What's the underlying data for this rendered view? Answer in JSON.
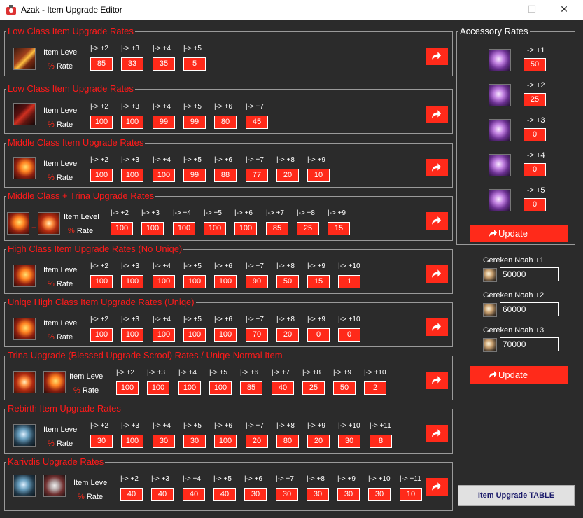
{
  "window": {
    "title": "Azak -  Item Upgrade Editor",
    "minimize": "—",
    "maximize": "☐",
    "close": "✕"
  },
  "labels": {
    "item_level": "Item Level",
    "rate": "% Rate"
  },
  "sections": [
    {
      "title": "Low Class Item Upgrade Rates",
      "levels": [
        "|-> +2",
        "|-> +3",
        "|-> +4",
        "|-> +5"
      ],
      "values": [
        "85",
        "33",
        "35",
        "5"
      ]
    },
    {
      "title": "Low Class Item Upgrade Rates",
      "levels": [
        "|-> +2",
        "|-> +3",
        "|-> +4",
        "|-> +5",
        "|-> +6",
        "|-> +7"
      ],
      "values": [
        "100",
        "100",
        "99",
        "99",
        "80",
        "45"
      ]
    },
    {
      "title": "Middle Class Item Upgrade Rates",
      "levels": [
        "|-> +2",
        "|-> +3",
        "|-> +4",
        "|-> +5",
        "|-> +6",
        "|-> +7",
        "|-> +8",
        "|-> +9"
      ],
      "values": [
        "100",
        "100",
        "100",
        "99",
        "88",
        "77",
        "20",
        "10"
      ]
    },
    {
      "title": "Middle Class + Trina Upgrade Rates",
      "levels": [
        "|-> +2",
        "|-> +3",
        "|-> +4",
        "|-> +5",
        "|-> +6",
        "|-> +7",
        "|-> +8",
        "|-> +9"
      ],
      "values": [
        "100",
        "100",
        "100",
        "100",
        "100",
        "85",
        "25",
        "15"
      ]
    },
    {
      "title": "High Class Item Upgrade Rates (No Uniqe)",
      "levels": [
        "|-> +2",
        "|-> +3",
        "|-> +4",
        "|-> +5",
        "|-> +6",
        "|-> +7",
        "|-> +8",
        "|-> +9",
        "|-> +10"
      ],
      "values": [
        "100",
        "100",
        "100",
        "100",
        "100",
        "90",
        "50",
        "15",
        "1"
      ]
    },
    {
      "title": "Uniqe High Class Item Upgrade Rates (Uniqe)",
      "levels": [
        "|-> +2",
        "|-> +3",
        "|-> +4",
        "|-> +5",
        "|-> +6",
        "|-> +7",
        "|-> +8",
        "|-> +9",
        "|-> +10"
      ],
      "values": [
        "100",
        "100",
        "100",
        "100",
        "100",
        "70",
        "20",
        "0",
        "0"
      ]
    },
    {
      "title": "Trina Upgrade (Blessed Upgrade Scrool) Rates / Uniqe-Normal Item",
      "levels": [
        "|-> +2",
        "|-> +3",
        "|-> +4",
        "|-> +5",
        "|-> +6",
        "|-> +7",
        "|-> +8",
        "|-> +9",
        "|-> +10"
      ],
      "values": [
        "100",
        "100",
        "100",
        "100",
        "85",
        "40",
        "25",
        "50",
        "2"
      ]
    },
    {
      "title": "Rebirth Item Upgrade Rates",
      "levels": [
        "|-> +2",
        "|-> +3",
        "|-> +4",
        "|-> +5",
        "|-> +6",
        "|-> +7",
        "|-> +8",
        "|-> +9",
        "|-> +10",
        "|-> +11"
      ],
      "values": [
        "30",
        "100",
        "30",
        "30",
        "100",
        "20",
        "80",
        "20",
        "30",
        "8"
      ]
    },
    {
      "title": "Karivdis Upgrade Rates",
      "levels": [
        "|-> +2",
        "|-> +3",
        "|-> +4",
        "|-> +5",
        "|-> +6",
        "|-> +7",
        "|-> +8",
        "|-> +9",
        "|-> +10",
        "|-> +11"
      ],
      "values": [
        "40",
        "40",
        "40",
        "40",
        "30",
        "30",
        "30",
        "30",
        "30",
        "10"
      ]
    }
  ],
  "accessory": {
    "title": "Accessory Rates",
    "levels": [
      "|-> +1",
      "|-> +2",
      "|-> +3",
      "|-> +4",
      "|-> +5"
    ],
    "values": [
      "50",
      "25",
      "0",
      "0",
      "0"
    ],
    "update_label": "Update"
  },
  "noah": {
    "items": [
      {
        "label": "Gereken Noah +1",
        "value": "50000"
      },
      {
        "label": "Gereken Noah +2",
        "value": "60000"
      },
      {
        "label": "Gereken Noah +3",
        "value": "70000"
      }
    ],
    "update_label": "Update"
  },
  "table_button": "Item Upgrade TABLE",
  "colors": {
    "accent": "#ff2a1a",
    "background": "#2b2b2b",
    "border": "#9a9a9a"
  }
}
